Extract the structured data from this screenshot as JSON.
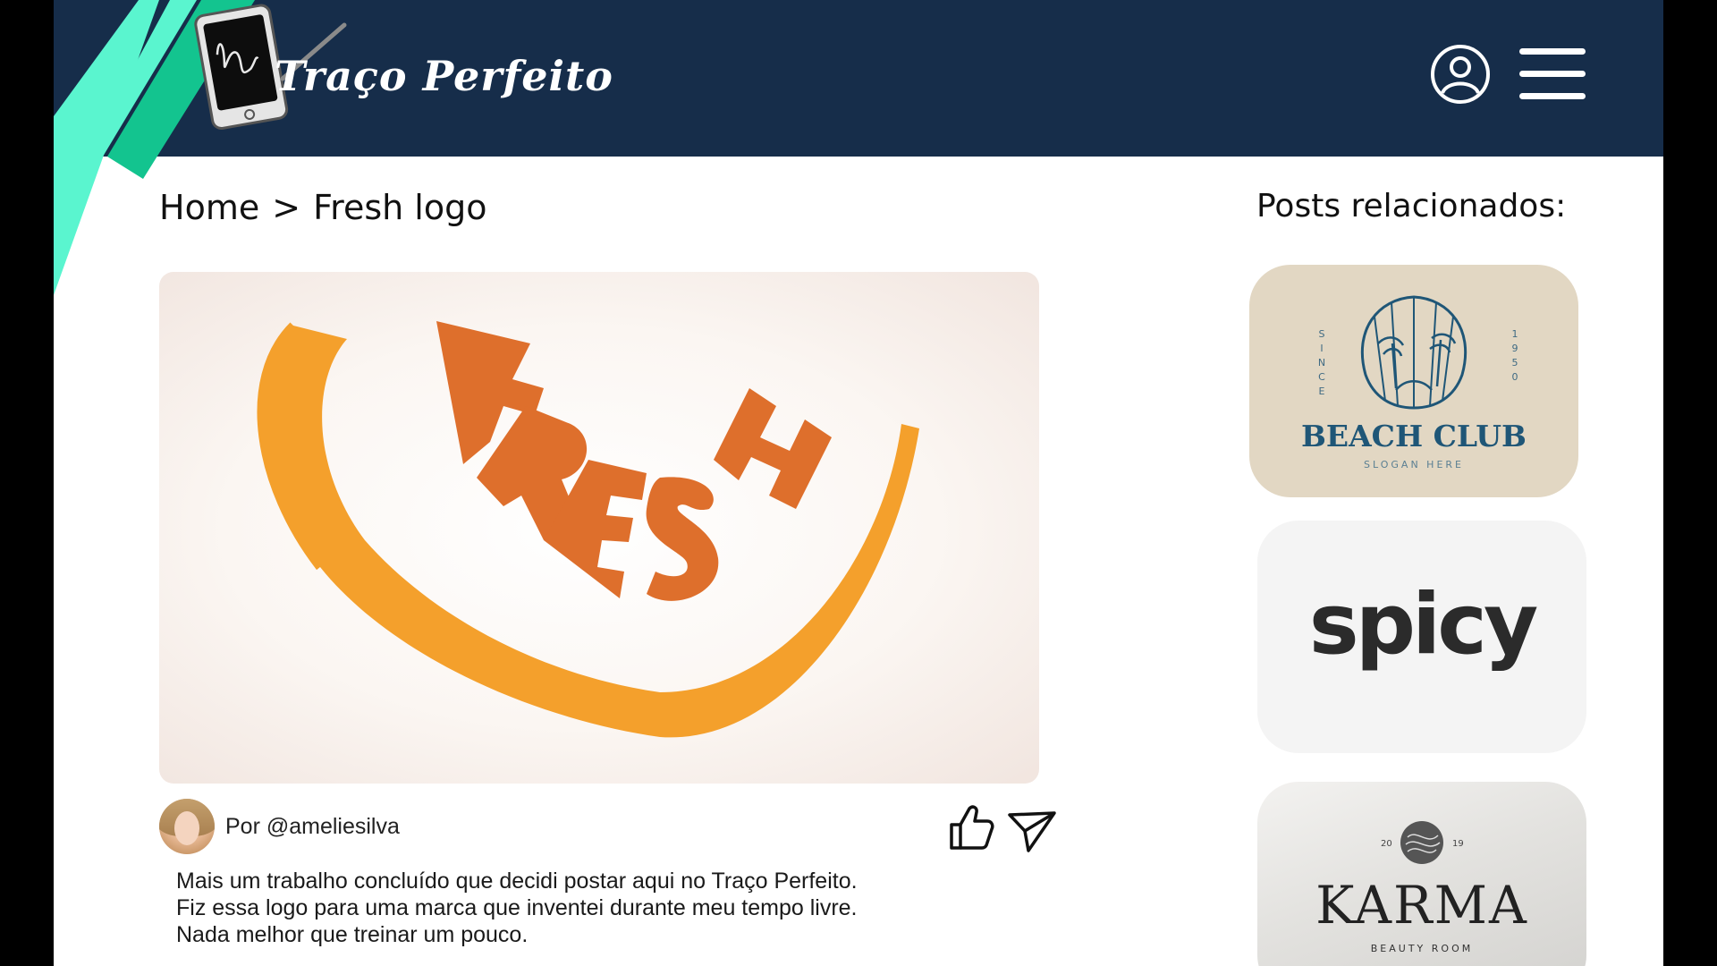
{
  "header": {
    "title": "Traço Perfeito",
    "colors": {
      "bar": "#162d4a",
      "stripe_light": "#5af5cf",
      "stripe_dark": "#13c48f"
    },
    "icons": {
      "logo": "tablet-signature-icon",
      "profile": "user-circle-icon",
      "menu": "hamburger-menu-icon"
    }
  },
  "breadcrumb": {
    "home": "Home",
    "separator": ">",
    "current": "Fresh logo"
  },
  "post": {
    "image_text": "FRESH",
    "image_colors": {
      "peel": "#f4a02c",
      "letters": "#de6f2c"
    },
    "author_label": "Por @ameliesilva",
    "actions": {
      "like": "thumbs-up-icon",
      "share": "send-icon"
    },
    "description": [
      "Mais um trabalho concluído que decidi postar aqui no Traço Perfeito.",
      "Fiz essa logo para uma marca que inventei durante meu tempo livre.",
      "Nada melhor que treinar um pouco."
    ]
  },
  "sidebar": {
    "title": "Posts relacionados:",
    "cards": [
      {
        "title": "BEACH CLUB",
        "slogan": "SLOGAN HERE",
        "side_left": "SINCE",
        "side_right": "1950",
        "icon": "seashell-palm-icon"
      },
      {
        "title": "spicy",
        "icon": "spicy-wordmark"
      },
      {
        "title": "KARMA",
        "subtitle": "BEAUTY ROOM",
        "year_left": "20",
        "year_right": "19",
        "icon": "karma-emblem-icon"
      }
    ]
  }
}
